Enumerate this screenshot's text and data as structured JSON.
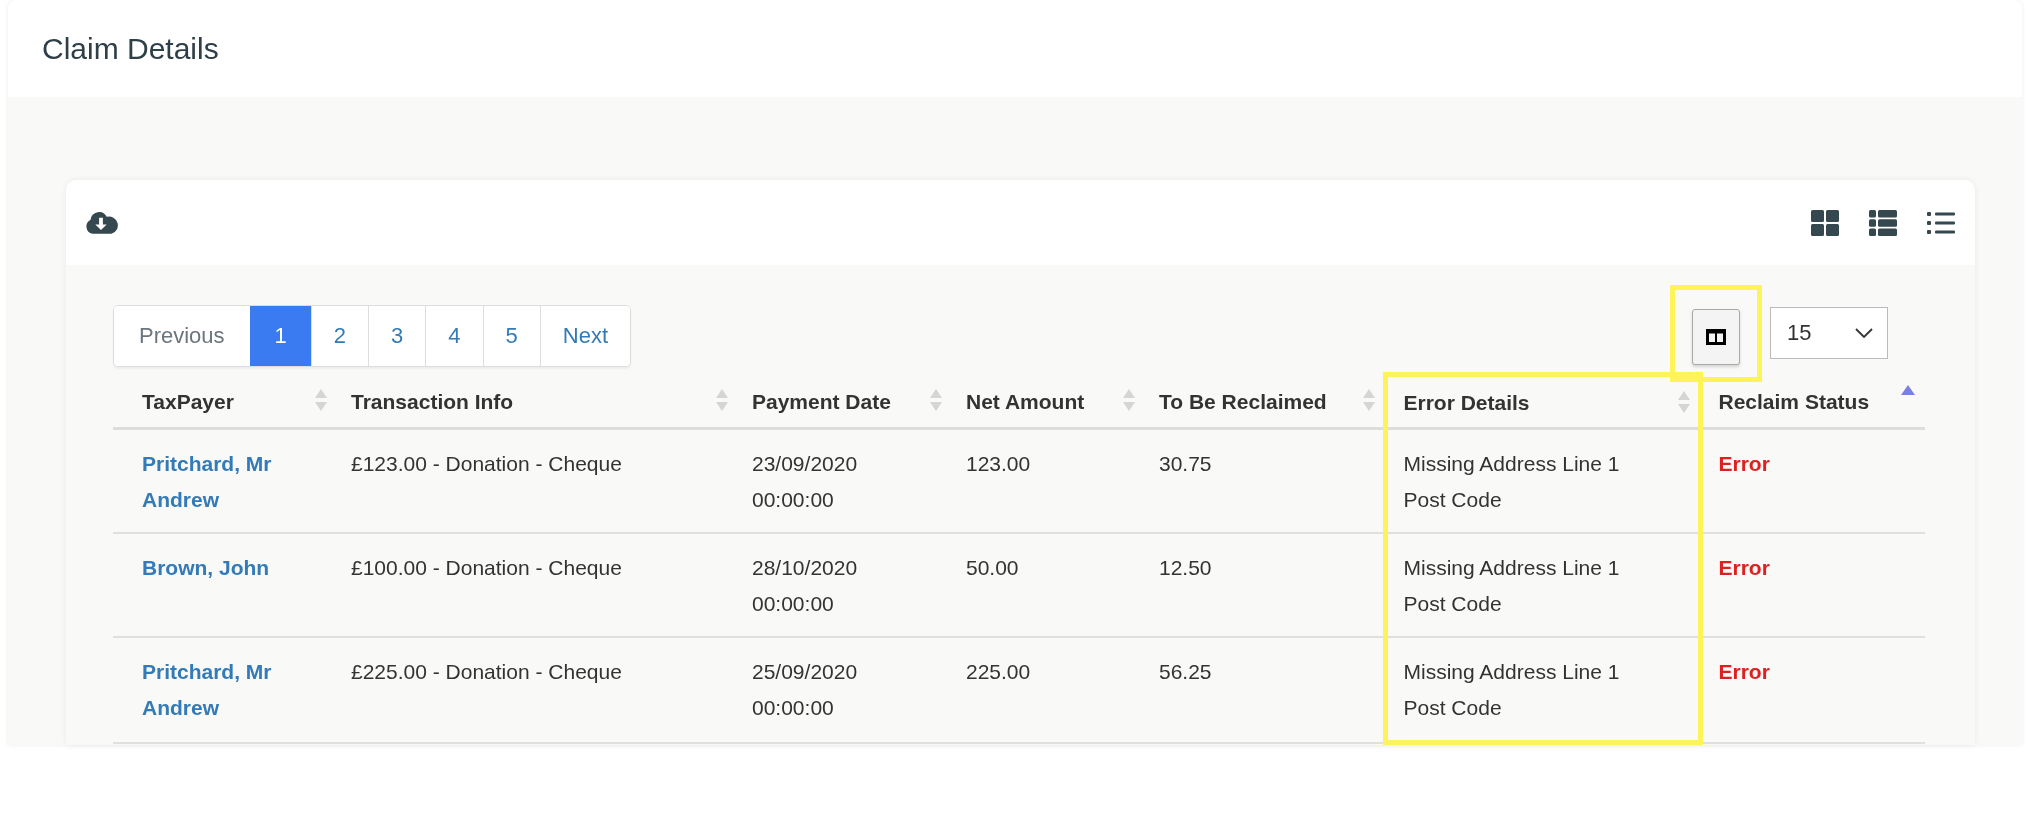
{
  "page": {
    "title": "Claim Details"
  },
  "pagination": {
    "previous": "Previous",
    "next": "Next",
    "pages": [
      {
        "label": "1",
        "selected": true
      },
      {
        "label": "2",
        "selected": false
      },
      {
        "label": "3",
        "selected": false
      },
      {
        "label": "4",
        "selected": false
      },
      {
        "label": "5",
        "selected": false
      }
    ]
  },
  "columns_button": {
    "highlighted": true
  },
  "page_size": {
    "value": "15"
  },
  "table": {
    "columns": [
      {
        "label": "TaxPayer",
        "sorted": false,
        "highlighted": false
      },
      {
        "label": "Transaction Info",
        "sorted": false,
        "highlighted": false
      },
      {
        "label": "Payment Date",
        "sorted": false,
        "highlighted": false
      },
      {
        "label": "Net Amount",
        "sorted": false,
        "highlighted": false
      },
      {
        "label": "To Be Reclaimed",
        "sorted": false,
        "highlighted": false
      },
      {
        "label": "Error Details",
        "sorted": false,
        "highlighted": true
      },
      {
        "label": "Reclaim Status",
        "sorted": true,
        "highlighted": false
      }
    ],
    "rows": [
      {
        "taxpayer": "Pritchard, Mr Andrew",
        "transaction": "£123.00 - Donation - Cheque",
        "date": "23/09/2020 00:00:00",
        "net": "123.00",
        "reclaim": "30.75",
        "errors": [
          "Missing Address Line 1",
          "Post Code"
        ],
        "status": "Error"
      },
      {
        "taxpayer": "Brown, John",
        "transaction": "£100.00 - Donation - Cheque",
        "date": "28/10/2020 00:00:00",
        "net": "50.00",
        "reclaim": "12.50",
        "errors": [
          "Missing Address Line 1",
          "Post Code"
        ],
        "status": "Error"
      },
      {
        "taxpayer": "Pritchard, Mr Andrew",
        "transaction": "£225.00 - Donation - Cheque",
        "date": "25/09/2020 00:00:00",
        "net": "225.00",
        "reclaim": "56.25",
        "errors": [
          "Missing Address Line 1",
          "Post Code"
        ],
        "status": "Error"
      }
    ]
  }
}
